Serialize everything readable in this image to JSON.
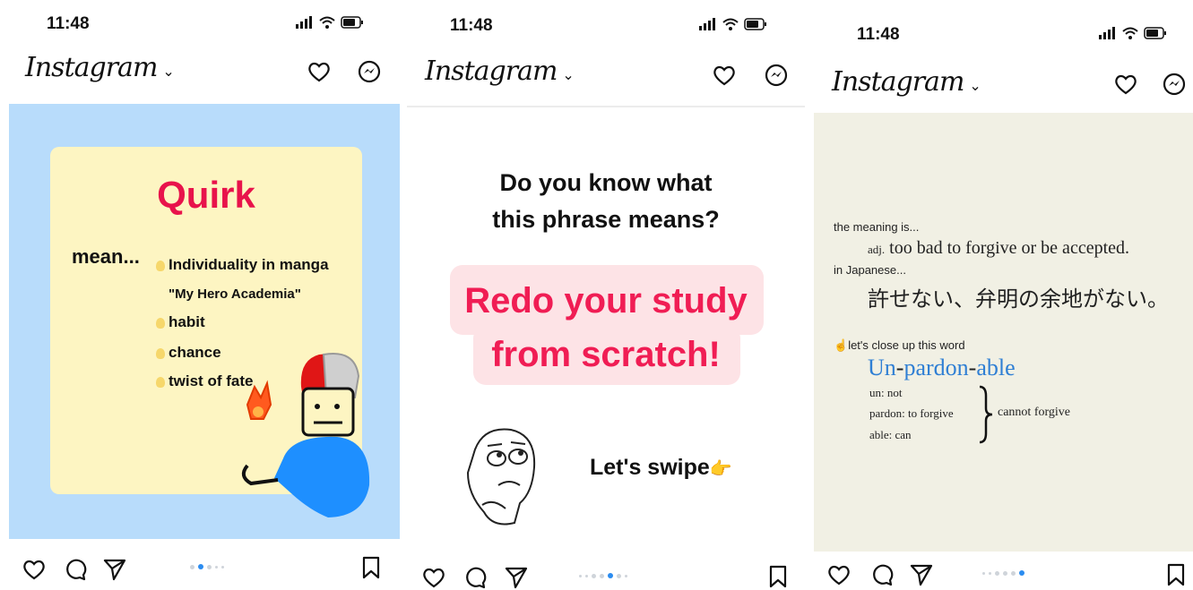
{
  "phones": [
    {
      "time": "11:48",
      "app_title": "Instagram",
      "post": {
        "word": "Quirk",
        "mean_label": "mean...",
        "items": [
          "Individuality in  manga",
          "\"My Hero Academia\"",
          "habit",
          "chance",
          "twist of fate"
        ]
      }
    },
    {
      "time": "11:48",
      "app_title": "Instagram",
      "post": {
        "question_line1": "Do you know what",
        "question_line2": "this phrase means?",
        "phrase_line1": "Redo your study",
        "phrase_line2": "from scratch!",
        "swipe_text": "Let's swipe",
        "swipe_emoji": "👉"
      }
    },
    {
      "time": "11:48",
      "app_title": "Instagram",
      "post": {
        "meaning_label": "the meaning is...",
        "pos": "adj.",
        "definition": "too bad to forgive or be accepted.",
        "japanese_label": "in Japanese...",
        "japanese": "許せない、弁明の余地がない。",
        "close_up_label": "let's close up this word",
        "word_part1": "Un",
        "word_part2": "pardon",
        "word_part3": "able",
        "dash": "-",
        "parts": [
          "un: not",
          "pardon: to forgive",
          "able: can"
        ],
        "result": "cannot forgive"
      }
    }
  ],
  "colors": {
    "post1_bg": "#b8dcfb",
    "post1_card": "#fdf5c2",
    "accent_red": "#e8134b",
    "post3_bg": "#f1f0e4",
    "link_blue": "#2f7fd4",
    "active_dot": "#2b8cf0"
  },
  "icons": [
    "signal-icon",
    "wifi-icon",
    "battery-icon",
    "heart-icon",
    "messenger-icon",
    "comment-icon",
    "share-icon",
    "bookmark-icon",
    "chevron-down-icon"
  ]
}
